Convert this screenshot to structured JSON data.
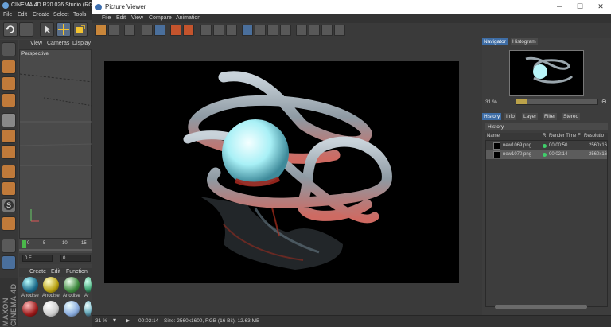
{
  "c4d": {
    "title": "CINEMA 4D R20.026 Studio (RC - R",
    "menu": [
      "File",
      "Edit",
      "Create",
      "Select",
      "Tools"
    ],
    "viewport_menu": [
      "View",
      "Cameras",
      "Display"
    ],
    "viewport_label": "Perspective",
    "timeline_ticks": [
      "0",
      "5",
      "10",
      "15"
    ],
    "frame_start": "0 F",
    "frame_current": "0",
    "material_menu": [
      "Create",
      "Edit",
      "Function"
    ],
    "materials": [
      "Anodise",
      "Anodise",
      "Anodise",
      "Ar"
    ],
    "brand": "MAXON CINEMA 4D"
  },
  "viewer": {
    "title": "Picture Viewer",
    "menu": [
      "File",
      "Edit",
      "View",
      "Compare",
      "Animation"
    ],
    "window_controls": [
      "–",
      "☐",
      "✕"
    ],
    "panel_tabs_top": [
      "Navigator",
      "Histogram"
    ],
    "zoom": "31 %",
    "panel_tabs": [
      "History",
      "Info",
      "Layer",
      "Filter",
      "Stereo"
    ],
    "history_title": "History",
    "columns": [
      "Name",
      "R",
      "Render Time",
      "F",
      "Resolutio"
    ],
    "history": [
      {
        "name": "new1069.png",
        "time": "00:00:50",
        "res": "2560x16"
      },
      {
        "name": "new1070.png",
        "time": "00:02:14",
        "res": "2560x16"
      }
    ],
    "status": {
      "zoom": "31 %",
      "time": "00:02:14",
      "info": "Size: 2560x1600, RGB (16 Bit), 12.63 MB"
    }
  },
  "colors": {
    "accent": "#3e6da5",
    "green": "#3fcf6a"
  }
}
